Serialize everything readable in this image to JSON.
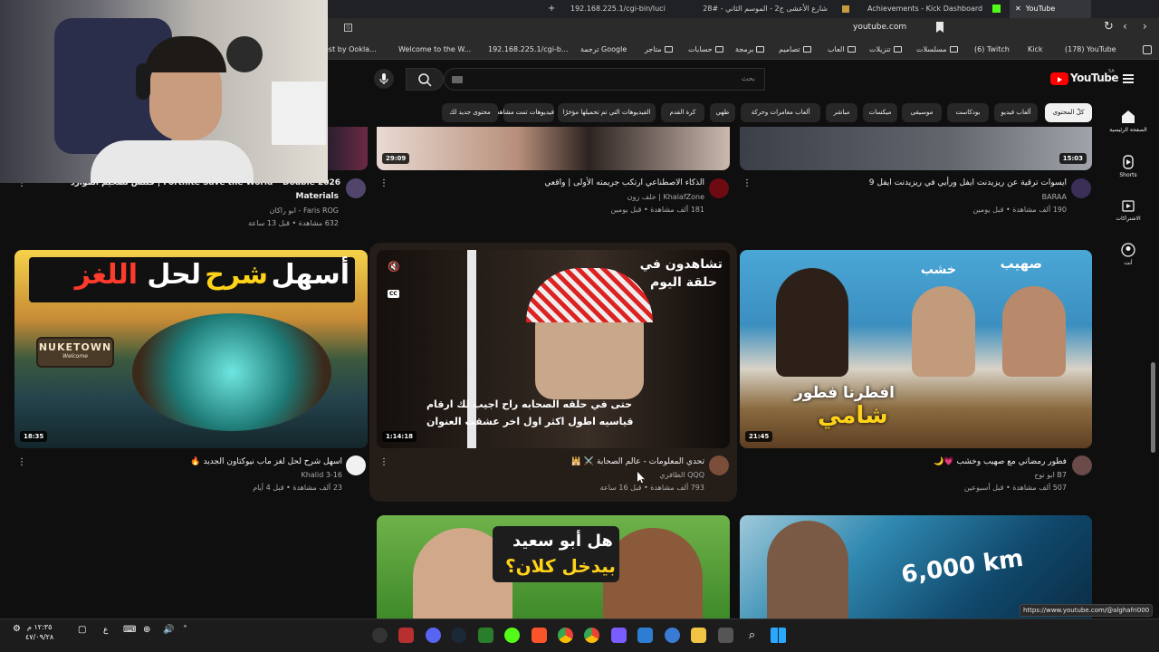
{
  "browser": {
    "tabs": [
      {
        "label": "192.168.225.1/cgi-bin/luci"
      },
      {
        "label": "شارع الأعشى ج2 - الموسم الثاني - #28"
      },
      {
        "label": "Achievements - Kick Dashboard"
      },
      {
        "label": "YouTube"
      }
    ],
    "url": "youtube.com",
    "bookmarks": [
      {
        "label": "est by Ookla..."
      },
      {
        "label": "Welcome to the W..."
      },
      {
        "label": "192.168.225.1/cgi-b..."
      },
      {
        "label": "Google ترجمة"
      },
      {
        "label": "متاجر"
      },
      {
        "label": "حسابات"
      },
      {
        "label": "برمجة"
      },
      {
        "label": "تصاميم"
      },
      {
        "label": "العاب"
      },
      {
        "label": "تنزيلات"
      },
      {
        "label": "مسلسلات"
      },
      {
        "label": "(6) Twitch"
      },
      {
        "label": "Kick"
      },
      {
        "label": "(178) YouTube"
      }
    ]
  },
  "youtube": {
    "logo": "YouTube",
    "region": "SA",
    "search_placeholder": "بحث",
    "chips": [
      "كلّ المحتوى",
      "ألعاب فيديو",
      "بودكاست",
      "موسيقى",
      "ميكسات",
      "مباشر",
      "ألعاب مغامرات وحركة",
      "طهي",
      "كرة القدم",
      "الفيديوهات التي تم تحميلها مؤخرًا",
      "فيديوهات تمت مشاهدتها",
      "محتوى جديد لك"
    ],
    "rail": [
      {
        "label": "الصفحة الرئيسية",
        "icon": "home-icon"
      },
      {
        "label": "Shorts",
        "icon": "shorts-icon"
      },
      {
        "label": "الاشتراكات",
        "icon": "subscriptions-icon"
      },
      {
        "label": "أنت",
        "icon": "you-icon"
      }
    ]
  },
  "videos_row1": [
    {
      "title": "ايسوات ترقية عن ريزيدنت ايفل ورأيي في ريزيدنت ايفل 9",
      "channel": "BARAA",
      "meta": "190 ألف مشاهدة • قبل يومين",
      "duration": "15:03"
    },
    {
      "title": "الذكاء الاصطناعي ارتكب جريمته الأولى | واقعي",
      "channel": "KhalafZone | خلف زون",
      "meta": "181 ألف مشاهدة • قبل يومين",
      "duration": "29:09"
    },
    {
      "title": "Fortnite Save the World – Double 2026 | قلتش تضخيم الموارد",
      "title2": "Materials",
      "channel": "Faris ROG - ابو راكان",
      "meta": "632 مشاهدة • قبل 13 ساعة",
      "duration": ""
    }
  ],
  "videos_row2": [
    {
      "title": "فطور رمضاني مع صهيب وخشب 💗🌙",
      "channel": "B7 ابو نوح",
      "meta": "507 ألف مشاهدة • قبل أسبوعين",
      "duration": "21:45",
      "overlay": [
        "صهيب",
        "خشب",
        "افطرنا فطور",
        "شامي"
      ]
    },
    {
      "title": "تحدي المعلومات - عالم الصحابة ⚔️ 🕌",
      "channel": "QQQ الظافري",
      "meta": "793 ألف مشاهدة • قبل 16 ساعة",
      "duration": "1:14:18",
      "overlay": [
        "تشاهدون في",
        "حلقة اليوم",
        "حتى في حلقه الصحابه راح اجيب لك ارقام",
        "قياسيه اطول اكثر اول اخر عشقت العنوان"
      ]
    },
    {
      "title": "اسهل شرح لحل لغز ماب نيوكتاون الجديد 🔥",
      "channel": "Khalid 3-16",
      "meta": "23 ألف مشاهدة • قبل 4 أيام",
      "duration": "18:35",
      "overlay": [
        "أسهل",
        "شرح",
        "لحل",
        "اللغز",
        "NUKETOWN",
        "Welcome"
      ]
    }
  ],
  "videos_row3": [
    {
      "overlay": [
        "6,000 km"
      ]
    },
    {
      "overlay": [
        "هل أبو سعيد",
        "بيدخل كلان؟"
      ]
    }
  ],
  "status_url": "https://www.youtube.com/@alghafri000",
  "taskbar": {
    "time": "١٢:٣٥ م",
    "date": "٤٧/٠٩/٢٨",
    "lang": "ع"
  },
  "colors": {
    "youtube_red": "#ff0000",
    "chip_selected": "#f1f1f1",
    "chip_bg": "#272727",
    "page_bg": "#0f0f0f"
  }
}
